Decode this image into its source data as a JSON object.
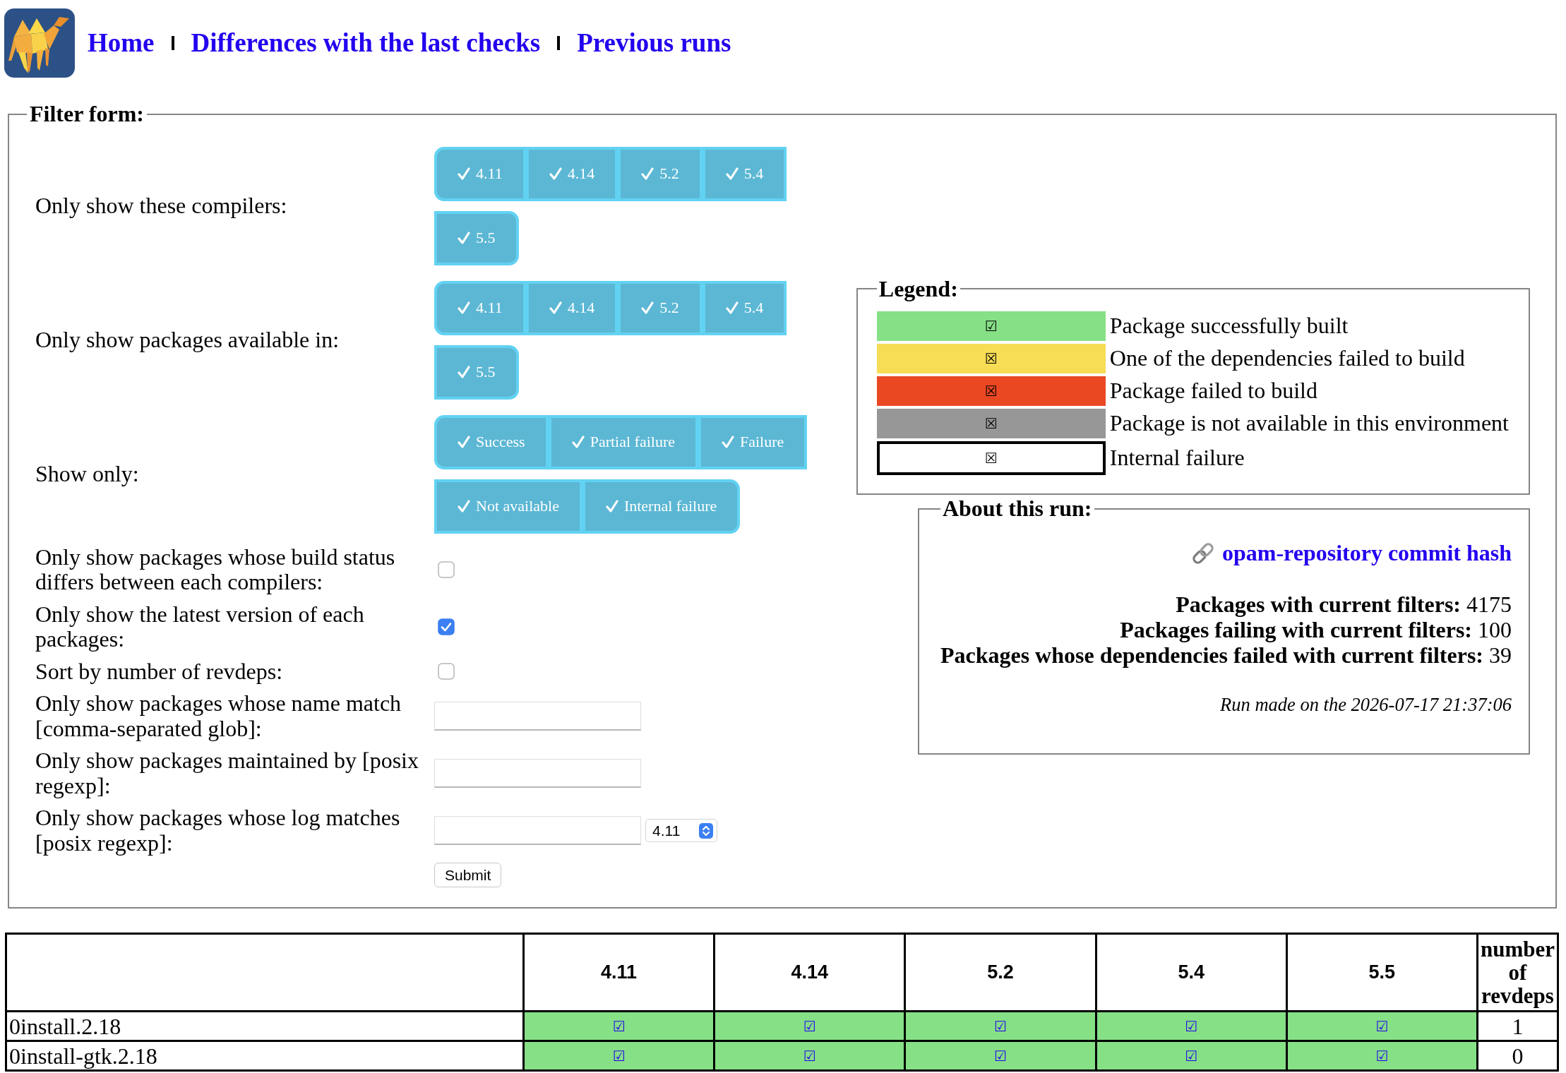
{
  "header": {
    "nav_links": [
      "Home",
      "Differences with the last checks",
      "Previous runs"
    ]
  },
  "filter_form": {
    "title": "Filter form:",
    "toggle_groups": [
      {
        "label": "Only show these compilers:",
        "options": [
          {
            "label": "4.11",
            "selected": true
          },
          {
            "label": "4.14",
            "selected": true
          },
          {
            "label": "5.2",
            "selected": true
          },
          {
            "label": "5.4",
            "selected": true
          },
          {
            "label": "5.5",
            "selected": true
          }
        ]
      },
      {
        "label": "Only show packages available in:",
        "options": [
          {
            "label": "4.11",
            "selected": true
          },
          {
            "label": "4.14",
            "selected": true
          },
          {
            "label": "5.2",
            "selected": true
          },
          {
            "label": "5.4",
            "selected": true
          },
          {
            "label": "5.5",
            "selected": true
          }
        ]
      },
      {
        "label": "Show only:",
        "options": [
          {
            "label": "Success",
            "selected": true
          },
          {
            "label": "Partial failure",
            "selected": true
          },
          {
            "label": "Failure",
            "selected": true
          },
          {
            "label": "Not available",
            "selected": true
          },
          {
            "label": "Internal failure",
            "selected": true
          }
        ]
      }
    ],
    "fields": [
      {
        "kind": "checkbox",
        "label": "Only show packages whose build status differs between each compilers:",
        "checked": false
      },
      {
        "kind": "checkbox",
        "label": "Only show the latest version of each packages:",
        "checked": true
      },
      {
        "kind": "checkbox",
        "label": "Sort by number of revdeps:",
        "checked": false
      },
      {
        "kind": "text",
        "label": "Only show packages whose name match [comma-separated glob]:"
      },
      {
        "kind": "text",
        "label": "Only show packages maintained by [posix regexp]:"
      },
      {
        "kind": "text_select",
        "label": "Only show packages whose log matches [posix regexp]:",
        "select_value": "4.11"
      }
    ],
    "submit": "Submit"
  },
  "legend": {
    "title": "Legend:",
    "items": [
      {
        "kind": "success",
        "color": "#86e086",
        "symbol": "☑",
        "label": "Package successfully built"
      },
      {
        "kind": "partial",
        "color": "#f7dc56",
        "symbol": "☒",
        "label": "One of the dependencies failed to build"
      },
      {
        "kind": "failure",
        "color": "#ea4723",
        "symbol": "☒",
        "label": "Package failed to build"
      },
      {
        "kind": "not_available",
        "color": "#979797",
        "symbol": "☒",
        "label": "Package is not available in this environment"
      },
      {
        "kind": "internal",
        "color": "#ffffff",
        "symbol": "☒",
        "label": "Internal failure"
      }
    ]
  },
  "about": {
    "title": "About this run:",
    "link": "opam-repository commit hash",
    "stats": [
      "**Packages with current filters:** 4175",
      "**Packages failing with current filters:** 100",
      "**Packages whose dependencies failed with current filters:** 39"
    ],
    "run_date": "Run made on the 2026-07-17 21:37:06"
  },
  "table": {
    "version_columns": [
      "4.11",
      "4.14",
      "5.2",
      "5.4",
      "5.5"
    ],
    "revdeps_column": "number of revdeps",
    "rows": [
      {
        "package": "0install.2.18",
        "cells": [
          {
            "kind": "success",
            "symbol": "☑"
          },
          {
            "kind": "success",
            "symbol": "☑"
          },
          {
            "kind": "success",
            "symbol": "☑"
          },
          {
            "kind": "success",
            "symbol": "☑"
          },
          {
            "kind": "success",
            "symbol": "☑"
          }
        ],
        "revdeps": "1"
      },
      {
        "package": "0install-gtk.2.18",
        "cells": [
          {
            "kind": "success",
            "symbol": "☑"
          },
          {
            "kind": "success",
            "symbol": "☑"
          },
          {
            "kind": "success",
            "symbol": "☑"
          },
          {
            "kind": "success",
            "symbol": "☑"
          },
          {
            "kind": "success",
            "symbol": "☑"
          }
        ],
        "revdeps": "0"
      }
    ]
  }
}
